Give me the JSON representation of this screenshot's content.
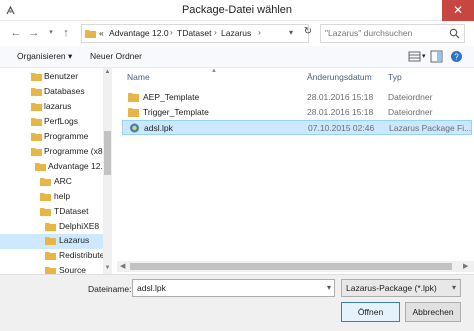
{
  "window": {
    "title": "Package-Datei wählen",
    "close_glyph": "✕"
  },
  "nav": {
    "back_glyph": "←",
    "forward_glyph": "→",
    "up_glyph": "↑"
  },
  "address": {
    "prefix": "«",
    "segments": [
      "Advantage 12.0",
      "TDataset",
      "Lazarus"
    ],
    "separator": "›"
  },
  "search": {
    "placeholder": "\"Lazarus\" durchsuchen"
  },
  "toolbar": {
    "organize_label": "Organisieren ▾",
    "new_folder_label": "Neuer Ordner"
  },
  "sidebar": {
    "items": [
      {
        "label": "Benutzer"
      },
      {
        "label": "Databases"
      },
      {
        "label": "lazarus"
      },
      {
        "label": "PerfLogs"
      },
      {
        "label": "Programme"
      },
      {
        "label": "Programme (x86)"
      },
      {
        "label": "Advantage 12.0"
      },
      {
        "label": "ARC"
      },
      {
        "label": "help"
      },
      {
        "label": "TDataset"
      },
      {
        "label": "DelphiXE8"
      },
      {
        "label": "Lazarus"
      },
      {
        "label": "Redistribute"
      },
      {
        "label": "Source"
      }
    ]
  },
  "filelist": {
    "columns": {
      "name": "Name",
      "modified": "Änderungsdatum",
      "type": "Typ"
    },
    "rows": [
      {
        "name": "AEP_Template",
        "modified": "28.01.2016 15:18",
        "type": "Dateiordner"
      },
      {
        "name": "Trigger_Template",
        "modified": "28.01.2016 15:18",
        "type": "Dateiordner"
      },
      {
        "name": "adsl.lpk",
        "modified": "07.10.2015 02:46",
        "type": "Lazarus Package Fi..."
      }
    ]
  },
  "footer": {
    "filename_label": "Dateiname:",
    "filename_value": "adsl.lpk",
    "filter_value": "Lazarus-Package (*.lpk)",
    "open_label": "Öffnen",
    "cancel_label": "Abbrechen"
  },
  "colors": {
    "accent": "#cce8ff",
    "close": "#c7463f",
    "folder": "#e8b547"
  }
}
